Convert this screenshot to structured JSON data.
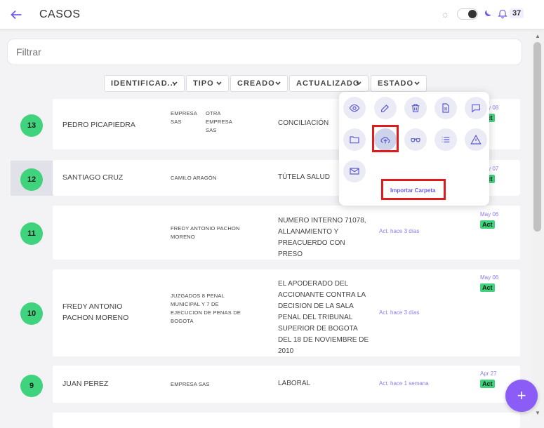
{
  "header": {
    "title": "CASOS",
    "notifications": "37"
  },
  "filter": {
    "placeholder": "Filtrar"
  },
  "columns": [
    {
      "label": "IDENTIFICAD..."
    },
    {
      "label": "TIPO"
    },
    {
      "label": "CREADO"
    },
    {
      "label": "ACTUALIZADO"
    },
    {
      "label": "ESTADO"
    }
  ],
  "rows": [
    {
      "num": "13",
      "name": "PEDRO PICAPIEDRA",
      "client_a": "EMPRESA SAS",
      "client_b": "OTRA EMPRESA SAS",
      "matter": "CONCILIACIÓN",
      "activity": "",
      "date": "May 08",
      "status": "Act"
    },
    {
      "num": "12",
      "name": "SANTIAGO CRUZ",
      "client": "CAMILO ARAGÓN",
      "matter": "TÚTELA SALUD",
      "activity": "",
      "date": "May 07",
      "status": "Act"
    },
    {
      "num": "11",
      "name": "",
      "client": "FREDY ANTONIO PACHON MORENO",
      "matter": "NUMERO INTERNO 71078, ALLANAMIENTO Y PREACUERDO CON PRESO",
      "activity": "Act. hace 3 días",
      "date": "May 06",
      "status": "Act"
    },
    {
      "num": "10",
      "name": "FREDY ANTONIO PACHON MORENO",
      "client": "JUZGADOS 8 PENAL MUNICIPAL Y 7 DE EJECUCION DE PENAS DE BOGOTA",
      "matter": "EL APODERADO DEL ACCIONANTE CONTRA LA DECISION DE LA SALA PENAL DEL TRIBUNAL SUPERIOR DE BOGOTA DEL 18 DE NOVIEMBRE DE 2010",
      "activity": "Act. hace 3 días",
      "date": "May 06",
      "status": "Act"
    },
    {
      "num": "9",
      "name": "JUAN PEREZ",
      "client": "EMPRESA SAS",
      "matter": "LABORAL",
      "activity": "Act. hace 1 semana",
      "date": "Apr 27",
      "status": "Act"
    }
  ],
  "popup": {
    "icons": [
      "eye-icon",
      "edit-icon",
      "trash-icon",
      "document-icon",
      "comment-icon",
      "folder-icon",
      "cloud-upload-icon",
      "glasses-icon",
      "list-icon",
      "warning-icon",
      "mail-icon"
    ],
    "tooltip": "Importar Carpeta"
  },
  "fab": {
    "label": "+"
  },
  "colors": {
    "accent": "#6c5ce7",
    "status_green": "#3ed37c",
    "highlight_red": "#e01b1b",
    "fab": "#8b5cf6"
  }
}
